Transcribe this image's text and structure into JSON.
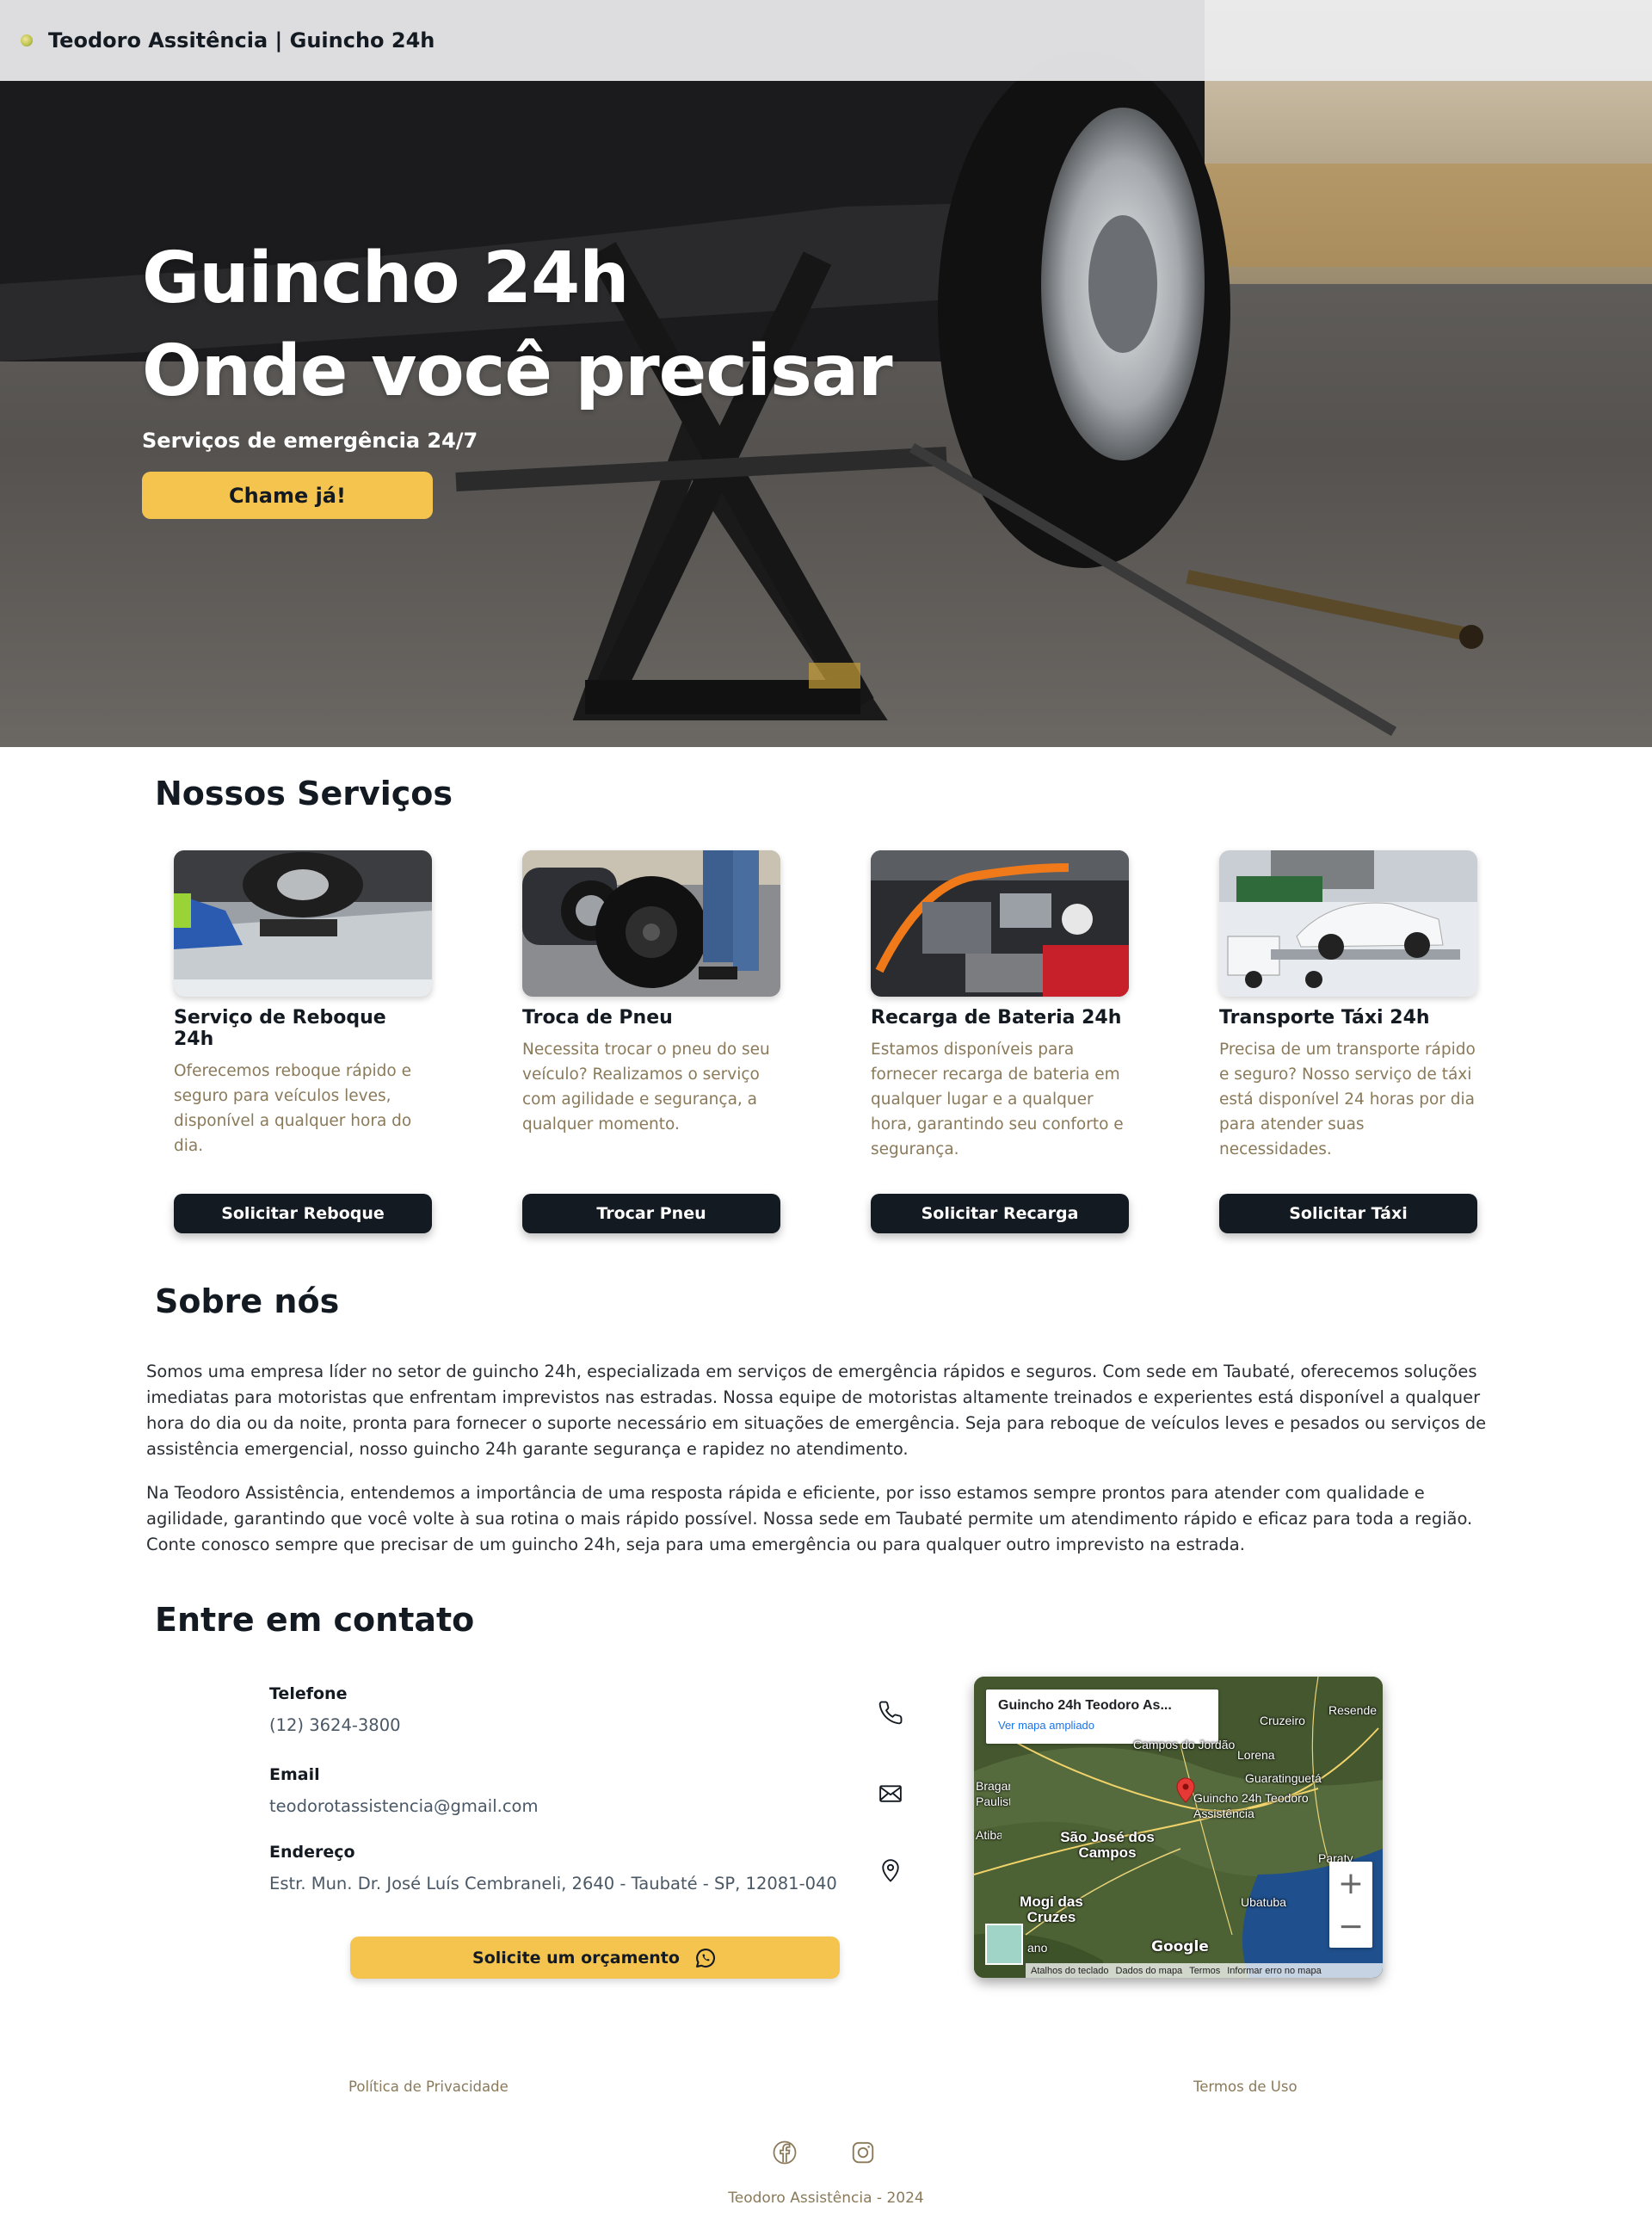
{
  "header": {
    "brand": "Teodoro Assitência | Guincho 24h"
  },
  "hero": {
    "title_line1": "Guincho 24h",
    "title_line2": "Onde você precisar",
    "subtitle": "Serviços de emergência 24/7",
    "cta_label": "Chame já!"
  },
  "services": {
    "title": "Nossos Serviços",
    "items": [
      {
        "title": "Serviço de Reboque 24h",
        "description": "Oferecemos reboque rápido e seguro para veículos leves, disponível a qualquer hora do dia.",
        "button": "Solicitar Reboque"
      },
      {
        "title": "Troca de Pneu",
        "description": "Necessita trocar o pneu do seu veículo? Realizamos o serviço com agilidade e segurança, a qualquer momento.",
        "button": "Trocar Pneu"
      },
      {
        "title": "Recarga de Bateria 24h",
        "description": "Estamos disponíveis para fornecer recarga de bateria em qualquer lugar e a qualquer hora, garantindo seu conforto e segurança.",
        "button": "Solicitar Recarga"
      },
      {
        "title": "Transporte Táxi 24h",
        "description": "Precisa de um transporte rápido e seguro? Nosso serviço de táxi está disponível 24 horas por dia para atender suas necessidades.",
        "button": "Solicitar Táxi"
      }
    ]
  },
  "about": {
    "title": "Sobre nós",
    "paragraph1": "Somos uma empresa líder no setor de guincho 24h, especializada em serviços de emergência rápidos e seguros. Com sede em Taubaté, oferecemos soluções imediatas para motoristas que enfrentam imprevistos nas estradas. Nossa equipe de motoristas altamente treinados e experientes está disponível a qualquer hora do dia ou da noite, pronta para fornecer o suporte necessário em situações de emergência. Seja para reboque de veículos leves e pesados ou serviços de assistência emergencial, nosso guincho 24h garante segurança e rapidez no atendimento.",
    "paragraph2": "Na Teodoro Assistência, entendemos a importância de uma resposta rápida e eficiente, por isso estamos sempre prontos para atender com qualidade e agilidade, garantindo que você volte à sua rotina o mais rápido possível. Nossa sede em Taubaté permite um atendimento rápido e eficaz para toda a região. Conte conosco sempre que precisar de um guincho 24h, seja para uma emergência ou para qualquer outro imprevisto na estrada."
  },
  "contact": {
    "title": "Entre em contato",
    "phone_label": "Telefone",
    "phone_value": "(12) 3624-3800",
    "email_label": "Email",
    "email_value": "teodorotassistencia@gmail.com",
    "address_label": "Endereço",
    "address_value": "Estr. Mun. Dr. José Luís Cembraneli, 2640 - Taubaté - SP, 12081-040",
    "quote_button": "Solicite um orçamento",
    "icons": [
      "phone-icon",
      "mail-icon",
      "map-pin-icon",
      "whatsapp-icon"
    ]
  },
  "map": {
    "place_name": "Guincho 24h Teodoro As...",
    "enlarge_link": "Ver mapa ampliado",
    "marker_label": "Guincho 24h Teodoro Assistência",
    "zoom_in": "+",
    "zoom_out": "−",
    "brand": "Google",
    "footer_items": [
      "Atalhos do teclado",
      "Dados do mapa",
      "Termos",
      "Informar erro no mapa"
    ],
    "labels": {
      "campos": "Campos do Jordão",
      "cruzeiro": "Cruzeiro",
      "resende": "Resende",
      "lorena": "Lorena",
      "guaratingueta": "Guaratinguetá",
      "sao_jose": "São José dos Campos",
      "mogi": "Mogi das Cruzes",
      "paraty": "Paraty",
      "ubatuba": "Ubatuba",
      "braganca": "Bragança Paulista",
      "atibaia": "Atibaia",
      "santo": "ano"
    }
  },
  "footer": {
    "privacy": "Política de Privacidade",
    "terms": "Termos de Uso",
    "social_icons": [
      "facebook-icon",
      "instagram-icon"
    ],
    "copyright": "Teodoro Assistência - 2024"
  },
  "colors": {
    "accent": "#f5c44f",
    "dark": "#141a21",
    "muted_text": "#8a7a5a"
  }
}
